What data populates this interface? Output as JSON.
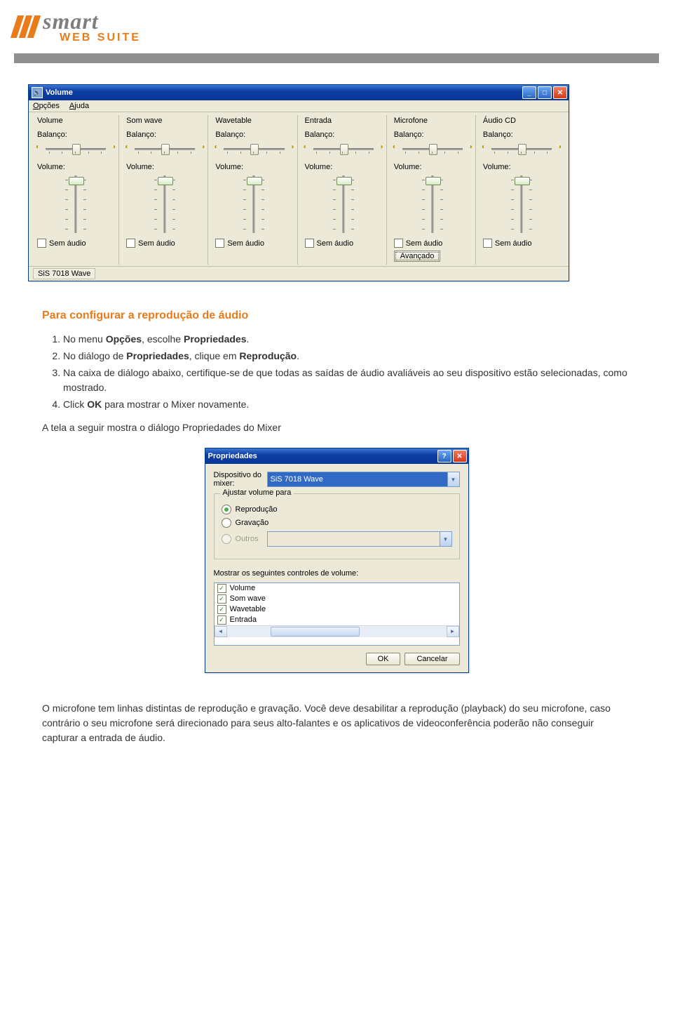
{
  "logo": {
    "brand": "smart",
    "subtitle": "WEB SUITE"
  },
  "mixer_window": {
    "title": "Volume",
    "menu": {
      "opcoes": "Opções",
      "ajuda": "Ajuda"
    },
    "labels": {
      "balanco": "Balanço:",
      "volume": "Volume:",
      "sem_audio": "Sem áudio",
      "avancado": "Avançado"
    },
    "channels": [
      {
        "name": "Volume",
        "has_advanced": false
      },
      {
        "name": "Som wave",
        "has_advanced": false
      },
      {
        "name": "Wavetable",
        "has_advanced": false
      },
      {
        "name": "Entrada",
        "has_advanced": false
      },
      {
        "name": "Microfone",
        "has_advanced": true
      },
      {
        "name": "Áudio CD",
        "has_advanced": false
      }
    ],
    "status": "SiS 7018 Wave"
  },
  "doc": {
    "heading": "Para configurar a reprodução de áudio",
    "steps": [
      "No menu Opções, escolhe Propriedades.",
      "No diálogo de Propriedades, clique em Reprodução.",
      "Na caixa de diálogo abaixo, certifique-se de que todas as saídas de áudio avaliáveis ao seu dispositivo estão selecionadas, como mostrado.",
      "Click OK para mostrar o Mixer novamente."
    ],
    "after_steps": "A tela a seguir mostra o diálogo Propriedades do Mixer",
    "footer": "O microfone tem linhas distintas de reprodução e gravação. Você deve desabilitar a reprodução (playback) do seu microfone, caso contrário o seu microfone será direcionado para seus alto-falantes e os aplicativos de videoconferência poderão não conseguir capturar a entrada de áudio."
  },
  "props_dialog": {
    "title": "Propriedades",
    "mixer_label": "Dispositivo do mixer:",
    "mixer_value": "SiS 7018 Wave",
    "group_legend": "Ajustar volume para",
    "radios": {
      "reproducao": "Reprodução",
      "gravacao": "Gravação",
      "outros": "Outros"
    },
    "list_label": "Mostrar os seguintes controles de volume:",
    "list_items": [
      "Volume",
      "Som wave",
      "Wavetable",
      "Entrada"
    ],
    "ok": "OK",
    "cancel": "Cancelar"
  }
}
